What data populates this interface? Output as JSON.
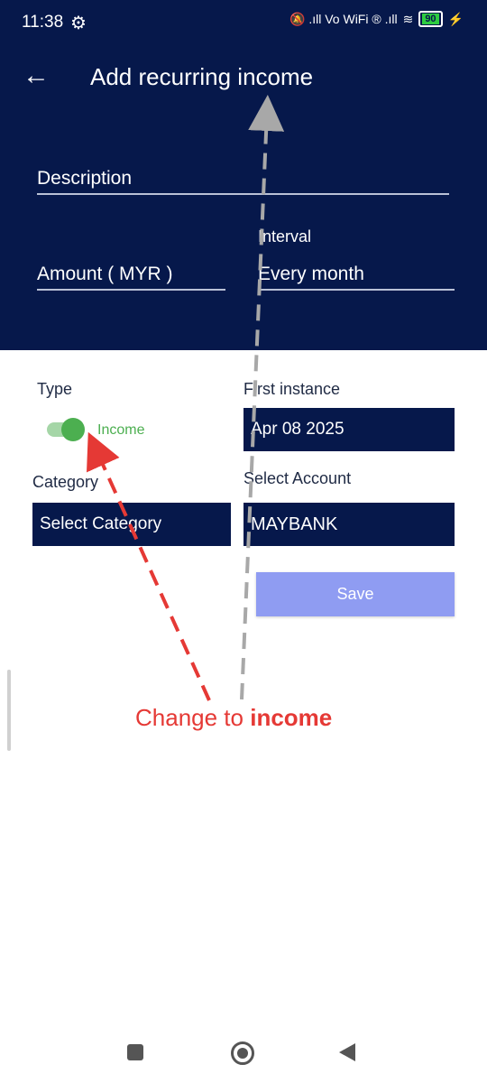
{
  "status_bar": {
    "time": "11:38",
    "gear_icon": "⚙",
    "icons_text": "🔕 .ıll Vo WiFi ® .ıll",
    "wifi_icon": "≋",
    "battery": "90",
    "charging_icon": "⚡"
  },
  "header": {
    "back_icon": "←",
    "title": "Add recurring income"
  },
  "form": {
    "description_label": "Description",
    "amount_label": "Amount ( MYR )",
    "interval_label": "Interval",
    "interval_value": "Every month",
    "type_label": "Type",
    "type_toggle_label": "Income",
    "first_instance_label": "First instance",
    "first_instance_value": "Apr 08 2025",
    "category_label": "Category",
    "category_value": "Select Category",
    "account_label": "Select Account",
    "account_value": "MAYBANK",
    "save_label": "Save"
  },
  "annotation": {
    "prefix": "Change to ",
    "emphasis": "income"
  },
  "colors": {
    "header_bg": "#06184b",
    "toggle_on": "#4caf50",
    "save_bg": "#8f9cf2",
    "annotation_red": "#e53935",
    "arrow_gray": "#a8a8a8"
  }
}
